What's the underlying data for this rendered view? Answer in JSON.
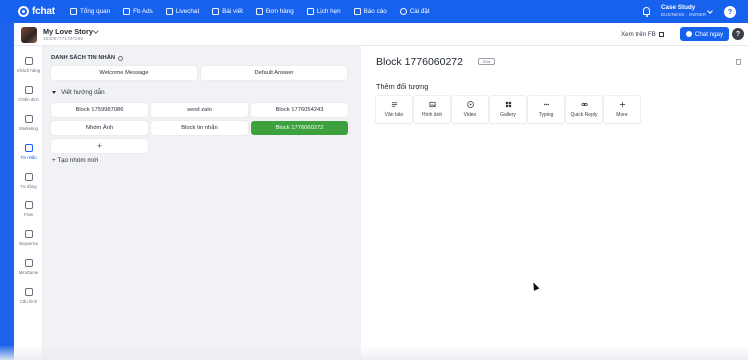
{
  "brand": {
    "name": "fchat",
    "accent": "#1661ee",
    "active_green": "#3da13d"
  },
  "nav": [
    {
      "label": "Tổng quan",
      "icon": "home-icon"
    },
    {
      "label": "Fb Ads",
      "icon": "megaphone-icon"
    },
    {
      "label": "Livechat",
      "icon": "chat-icon"
    },
    {
      "label": "Bài viết",
      "icon": "post-icon"
    },
    {
      "label": "Đơn hàng",
      "icon": "cart-icon"
    },
    {
      "label": "Lịch hẹn",
      "icon": "calendar-icon"
    },
    {
      "label": "Báo cáo",
      "icon": "chart-icon"
    },
    {
      "label": "Cài đặt",
      "icon": "gear-icon"
    }
  ],
  "account": {
    "name": "Case Study",
    "role": "BUSINESS - OWNER",
    "avatar_letter": "?"
  },
  "page": {
    "name": "My Love Story",
    "id": "102057771707255"
  },
  "header_actions": {
    "view_fb": "Xem trên FB",
    "chat_now": "Chat ngay",
    "help": "?"
  },
  "sidebar": [
    {
      "label": "Khách hàng",
      "icon": "user-icon"
    },
    {
      "label": "Chiến dịch",
      "icon": "lightning-icon"
    },
    {
      "label": "Marketing",
      "icon": "megaphone-icon"
    },
    {
      "label": "Tin nhắn",
      "icon": "message-icon",
      "active": true
    },
    {
      "label": "Tự động",
      "icon": "automation-icon"
    },
    {
      "label": "Flow",
      "icon": "flow-icon"
    },
    {
      "label": "Sequence",
      "icon": "sequence-icon"
    },
    {
      "label": "MiniGame",
      "icon": "gamepad-icon"
    },
    {
      "label": "Cấu hình",
      "icon": "settings-icon"
    }
  ],
  "messages": {
    "title": "DANH SÁCH TIN NHẮN",
    "defaults": [
      "Welcome Message",
      "Default Answer"
    ],
    "group": {
      "name": "Viết hướng dẫn",
      "blocks": [
        "Block 1759987086",
        "send zalo",
        "Block 1776054243",
        "Nhóm Ảnh",
        "Block tin nhắn",
        "Block 1776060272"
      ],
      "active_block": "Block 1776060272",
      "add_symbol": "+"
    },
    "new_group": "+ Tạo nhóm mới"
  },
  "editor": {
    "title": "Block 1776060272",
    "edit_badge": "Sửa",
    "add_object_title": "Thêm đối tượng",
    "objects": [
      {
        "label": "Văn bản",
        "icon": "text-icon"
      },
      {
        "label": "Hình ảnh",
        "icon": "image-icon"
      },
      {
        "label": "Video",
        "icon": "video-icon"
      },
      {
        "label": "Gallery",
        "icon": "gallery-icon"
      },
      {
        "label": "Typing",
        "icon": "typing-icon"
      },
      {
        "label": "Quick Reply",
        "icon": "link-icon"
      },
      {
        "label": "More",
        "icon": "plus-icon"
      }
    ]
  }
}
